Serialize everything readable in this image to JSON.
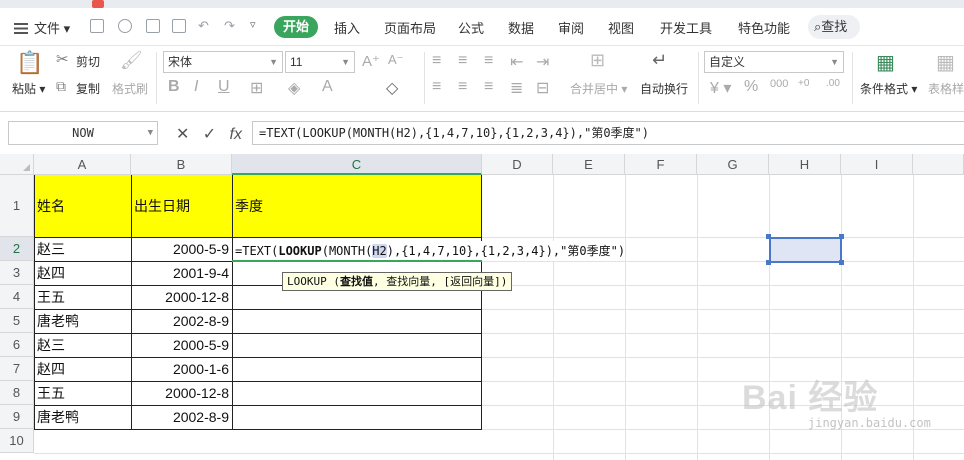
{
  "menu": {
    "file_label": "文件",
    "tabs": [
      "开始",
      "插入",
      "页面布局",
      "公式",
      "数据",
      "审阅",
      "视图",
      "开发工具",
      "特色功能"
    ],
    "active_tab": "开始",
    "search_label": "查找"
  },
  "ribbon": {
    "paste_label": "粘贴",
    "cut_label": "剪切",
    "copy_label": "复制",
    "format_painter_label": "格式刷",
    "font_name": "宋体",
    "font_size": "11",
    "merge_label": "合并居中",
    "wrap_label": "自动换行",
    "number_format": "自定义",
    "conditional_format_label": "条件格式",
    "table_style_label": "表格样"
  },
  "formula_bar": {
    "name_box": "NOW",
    "formula": "=TEXT(LOOKUP(MONTH(H2),{1,4,7,10},{1,2,3,4}),\"第0季度\")",
    "fx_label": "fx"
  },
  "grid": {
    "columns": [
      "A",
      "B",
      "C",
      "D",
      "E",
      "F",
      "G",
      "H",
      "I"
    ],
    "rows": [
      "1",
      "2",
      "3",
      "4",
      "5",
      "6",
      "7",
      "8",
      "9",
      "10"
    ],
    "headers": {
      "a": "姓名",
      "b": "出生日期",
      "c": "季度"
    },
    "data": [
      {
        "name": "赵三",
        "date": "2000-5-9"
      },
      {
        "name": "赵四",
        "date": "2001-9-4"
      },
      {
        "name": "王五",
        "date": "2000-12-8"
      },
      {
        "name": "唐老鸭",
        "date": "2002-8-9"
      },
      {
        "name": "赵三",
        "date": "2000-5-9"
      },
      {
        "name": "赵四",
        "date": "2000-1-6"
      },
      {
        "name": "王五",
        "date": "2000-12-8"
      },
      {
        "name": "唐老鸭",
        "date": "2002-8-9"
      }
    ],
    "editing": {
      "prefix": "=TEXT(",
      "func": "LOOKUP",
      "open": "(MONTH(",
      "ref": "H2",
      "rest": "),{1,4,7,10},{1,2,3,4}),\"第0季度\")"
    },
    "tooltip": {
      "func": "LOOKUP (",
      "arg_bold": "查找值",
      "rest": ", 查找向量, [返回向量])"
    }
  },
  "watermark": {
    "main": "Bai 经验",
    "sub": "jingyan.baidu.com"
  },
  "colors": {
    "accent": "#3aa55d",
    "header_fill": "#ffff00",
    "selection": "#4a78c9"
  }
}
